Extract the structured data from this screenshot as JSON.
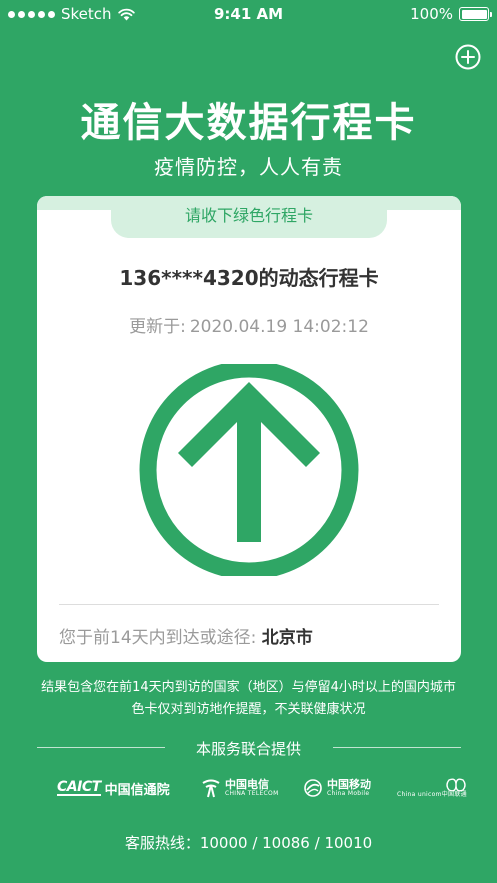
{
  "status_bar": {
    "carrier": "Sketch",
    "time": "9:41 AM",
    "battery": "100%"
  },
  "header": {
    "title": "通信大数据行程卡",
    "subtitle": "疫情防控，人人有责"
  },
  "card": {
    "tab_label": "请收下绿色行程卡",
    "phone_title": "136****4320的动态行程卡",
    "update_label": "更新于:",
    "update_time": "2020.04.19 14:02:12",
    "route_label": "您于前14天内到达或途径:",
    "route_city": "北京市"
  },
  "notes": {
    "line1": "结果包含您在前14天内到访的国家（地区）与停留4小时以上的国内城市",
    "line2": "色卡仅对到访地作提醒，不关联健康状况"
  },
  "providers": {
    "title": "本服务联合提供",
    "caict_en": "CAICT",
    "caict_cn": "中国信通院",
    "telecom_cn": "中国电信",
    "telecom_en": "CHINA TELECOM",
    "mobile_cn": "中国移动",
    "mobile_en": "China Mobile",
    "unicom_en": "China unicom中国联通"
  },
  "hotline": "客服热线：10000 / 10086 / 10010",
  "colors": {
    "background": "#2fa665",
    "tab_bg": "#d6f0e0",
    "arrow": "#2fa665"
  },
  "icons": {
    "add": "plus-circle-icon",
    "wifi": "wifi-icon",
    "battery": "battery-icon",
    "arrow": "up-arrow-circle-icon"
  }
}
